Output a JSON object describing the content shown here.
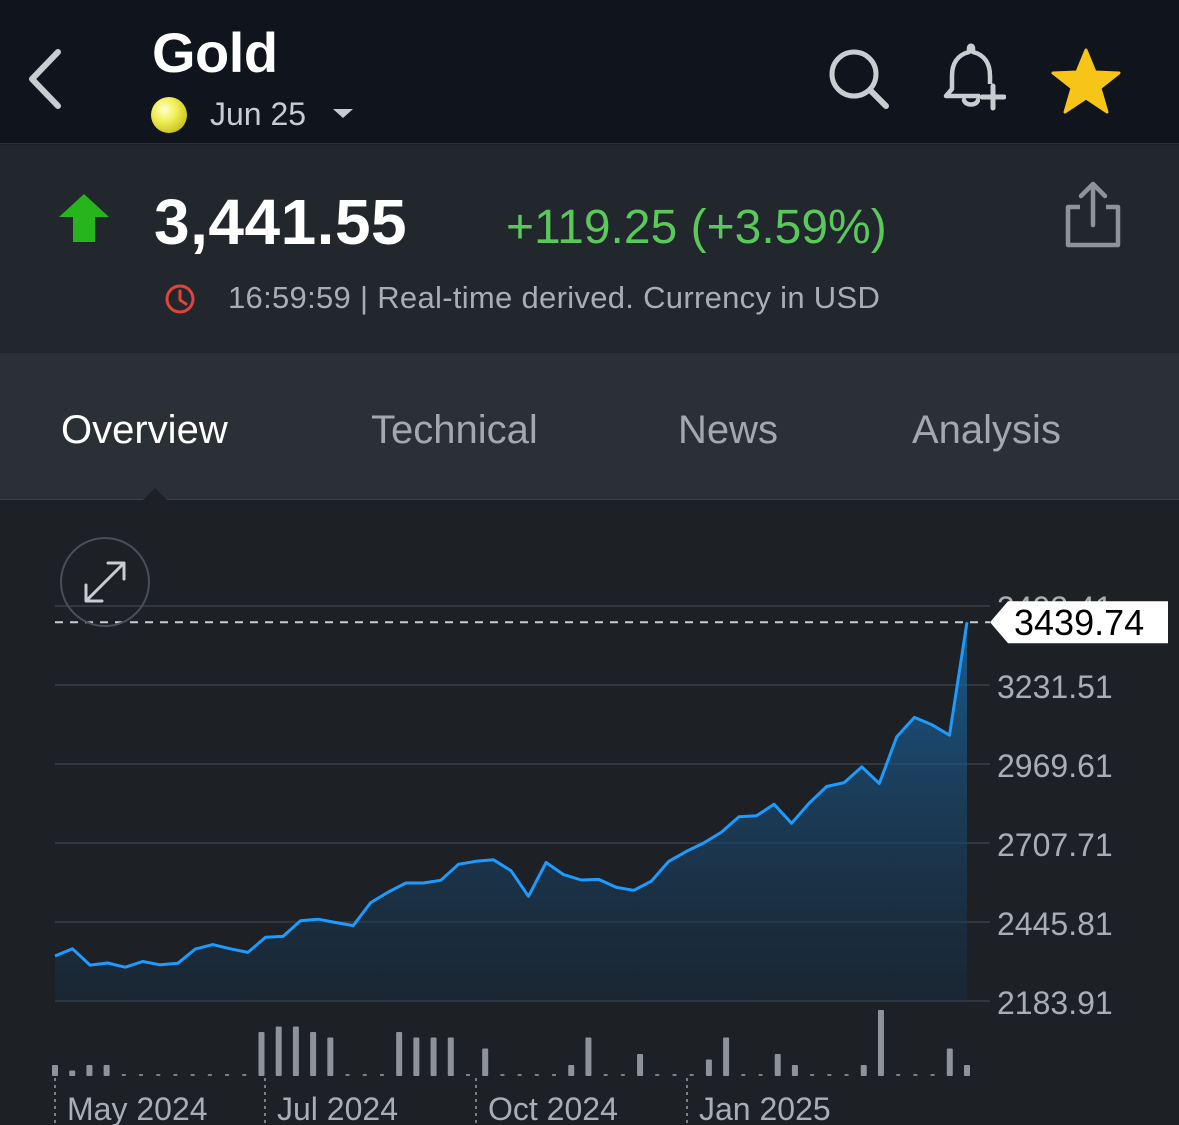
{
  "header": {
    "title": "Gold",
    "contract": "Jun 25",
    "icons": {
      "back": "chevron-left-icon",
      "search": "search-icon",
      "alert": "bell-plus-icon",
      "watchlist": "star-icon"
    }
  },
  "quote": {
    "price": "3,441.55",
    "change": "+119.25 (+3.59%)",
    "time": "16:59:59",
    "meta": "16:59:59 | Real-time derived. Currency in USD",
    "direction": "up"
  },
  "tabs": [
    {
      "label": "Overview",
      "active": true
    },
    {
      "label": "Technical",
      "active": false
    },
    {
      "label": "News",
      "active": false
    },
    {
      "label": "Analysis",
      "active": false
    }
  ],
  "colors": {
    "up": "#5ac85a",
    "line": "#1e9bff",
    "star": "#f6c518",
    "clock": "#e0443a"
  },
  "chart_data": {
    "type": "area",
    "current_value_label": "3439.74",
    "y_ticks": [
      "3493.41",
      "3231.51",
      "2969.61",
      "2707.71",
      "2445.81",
      "2183.91"
    ],
    "ylim": [
      2183.91,
      3493.41
    ],
    "x_labels": [
      "May 2024",
      "Jul 2024",
      "Oct 2024",
      "Jan 2025"
    ],
    "series": [
      {
        "values": [
          2333,
          2357,
          2303,
          2310,
          2296,
          2315,
          2304,
          2309,
          2356,
          2371,
          2357,
          2345,
          2395,
          2398,
          2450,
          2455,
          2444,
          2434,
          2510,
          2545,
          2575,
          2575,
          2584,
          2637,
          2647,
          2652,
          2616,
          2531,
          2643,
          2603,
          2585,
          2587,
          2561,
          2551,
          2581,
          2647,
          2680,
          2708,
          2744,
          2795,
          2798,
          2836,
          2773,
          2840,
          2895,
          2908,
          2960,
          2905,
          3060,
          3124,
          3100,
          3065,
          3439.74
        ]
      }
    ],
    "volume": [
      2,
      1,
      2,
      2,
      0,
      0,
      0,
      0,
      0,
      0,
      0,
      0,
      8,
      9,
      9,
      8,
      7,
      0,
      0,
      0,
      8,
      7,
      7,
      7,
      0,
      5,
      0,
      0,
      0,
      0,
      2,
      7,
      0,
      0,
      4,
      0,
      0,
      0,
      3,
      7,
      0,
      0,
      4,
      2,
      0,
      0,
      0,
      2,
      12,
      0,
      0,
      0,
      5,
      2
    ],
    "grid": true,
    "xlabel": "",
    "ylabel": ""
  }
}
